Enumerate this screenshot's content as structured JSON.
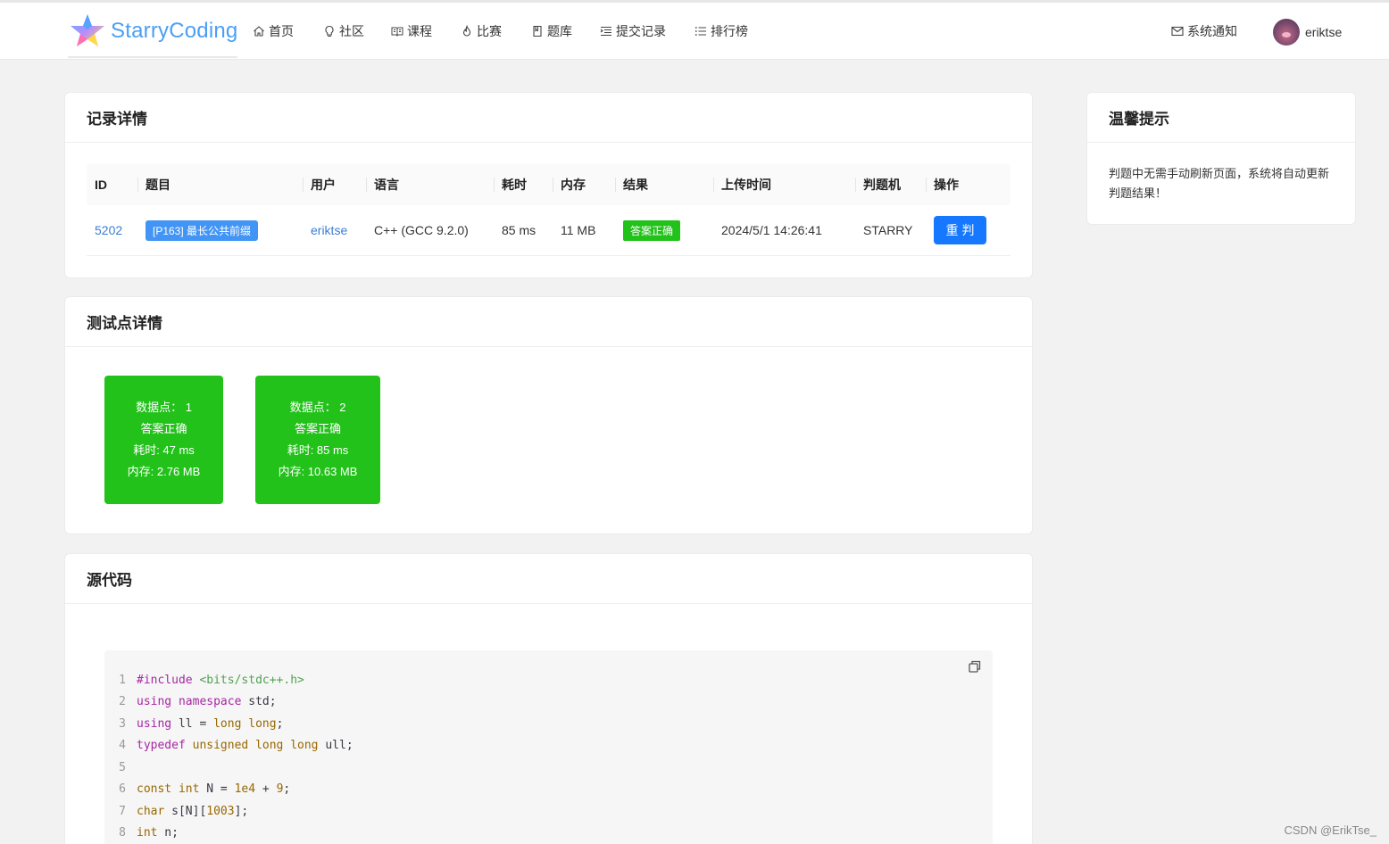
{
  "brand": {
    "name": "StarryCoding"
  },
  "nav": {
    "items": [
      {
        "label": "首页",
        "icon": "home-icon"
      },
      {
        "label": "社区",
        "icon": "bulb-icon"
      },
      {
        "label": "课程",
        "icon": "book-icon"
      },
      {
        "label": "比赛",
        "icon": "fire-icon"
      },
      {
        "label": "题库",
        "icon": "bookmark-icon"
      },
      {
        "label": "提交记录",
        "icon": "indent-icon"
      },
      {
        "label": "排行榜",
        "icon": "list-icon"
      }
    ],
    "notify_label": "系统通知",
    "username": "eriktse"
  },
  "record": {
    "title": "记录详情",
    "headers": [
      "ID",
      "题目",
      "用户",
      "语言",
      "耗时",
      "内存",
      "结果",
      "上传时间",
      "判题机",
      "操作"
    ],
    "row": {
      "id": "5202",
      "problem": "[P163] 最长公共前缀",
      "user": "eriktse",
      "language": "C++ (GCC 9.2.0)",
      "time": "85 ms",
      "memory": "11 MB",
      "result": "答案正确",
      "uploaded": "2024/5/1 14:26:41",
      "judger": "STARRY",
      "action": "重判"
    },
    "colors": {
      "accepted": "#22c21a",
      "problem_tag": "#4294f5",
      "button": "#1677ff",
      "link": "#3a7ed6"
    }
  },
  "testpoints": {
    "title": "测试点详情",
    "items": [
      {
        "point": "数据点： 1",
        "status": "答案正确",
        "time": "耗时: 47 ms",
        "memory": "内存: 2.76 MB"
      },
      {
        "point": "数据点： 2",
        "status": "答案正确",
        "time": "耗时: 85 ms",
        "memory": "内存: 10.63 MB"
      }
    ]
  },
  "source": {
    "title": "源代码",
    "line_numbers": [
      "1",
      "2",
      "3",
      "4",
      "5",
      "6",
      "7",
      "8"
    ],
    "lines": [
      [
        {
          "t": "#include ",
          "c": "kw"
        },
        {
          "t": "<bits/stdc++.h>",
          "c": "str"
        }
      ],
      [
        {
          "t": "using",
          "c": "kw"
        },
        {
          "t": " ",
          "c": "tx"
        },
        {
          "t": "namespace",
          "c": "kw"
        },
        {
          "t": " std;",
          "c": "tx"
        }
      ],
      [
        {
          "t": "using",
          "c": "kw"
        },
        {
          "t": " ll = ",
          "c": "tx"
        },
        {
          "t": "long long",
          "c": "ty"
        },
        {
          "t": ";",
          "c": "tx"
        }
      ],
      [
        {
          "t": "typedef",
          "c": "kw"
        },
        {
          "t": " ",
          "c": "tx"
        },
        {
          "t": "unsigned long long",
          "c": "ty"
        },
        {
          "t": " ull;",
          "c": "tx"
        }
      ],
      [],
      [
        {
          "t": "const int",
          "c": "ty"
        },
        {
          "t": " N = ",
          "c": "tx"
        },
        {
          "t": "1e4",
          "c": "num"
        },
        {
          "t": " + ",
          "c": "tx"
        },
        {
          "t": "9",
          "c": "num"
        },
        {
          "t": ";",
          "c": "tx"
        }
      ],
      [
        {
          "t": "char",
          "c": "ty"
        },
        {
          "t": " s[N][",
          "c": "tx"
        },
        {
          "t": "1003",
          "c": "num"
        },
        {
          "t": "];",
          "c": "tx"
        }
      ],
      [
        {
          "t": "int",
          "c": "ty"
        },
        {
          "t": " n;",
          "c": "tx"
        }
      ]
    ]
  },
  "tips": {
    "title": "温馨提示",
    "text": "判题中无需手动刷新页面，系统将自动更新判题结果！"
  },
  "watermark": "CSDN @ErikTse_"
}
